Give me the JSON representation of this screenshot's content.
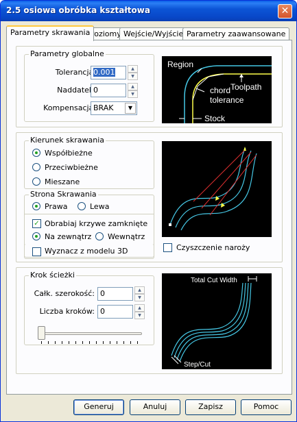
{
  "window": {
    "title": "2.5 osiowa obróbka kształtowa",
    "close_glyph": "✕"
  },
  "tabs": [
    "Parametry skrawania",
    "Poziomy",
    "Wejście/Wyjście",
    "Parametry zaawansowane"
  ],
  "active_tab": 0,
  "global": {
    "title": "Parametry globalne",
    "tolerance_label": "Tolerancja:",
    "tolerance_value": "0.001",
    "allowance_label": "Naddatek:",
    "allowance_value": "0",
    "compensation_label": "Kompensacja:",
    "compensation_value": "BRAK"
  },
  "diagram1": {
    "region": "Region",
    "toolpath": "Toolpath",
    "chord": "chord",
    "tolerance": "tolerance",
    "stock": "Stock"
  },
  "direction": {
    "title": "Kierunek skrawania",
    "options": [
      "Współbieżne",
      "Przeciwbieżne",
      "Mieszane"
    ],
    "selected": 0
  },
  "side": {
    "title": "Strona Skrawania",
    "options": [
      "Prawa",
      "Lewa"
    ],
    "selected": 0
  },
  "closed_curves": {
    "label": "Obrabiaj krzywe zamknięte",
    "checked": true,
    "options": [
      "Na zewnątrz",
      "Wewnątrz"
    ],
    "selected": 0
  },
  "from_model": {
    "label": "Wyznacz z modelu 3D",
    "checked": false
  },
  "corner_clean": {
    "label": "Czyszczenie naroży",
    "checked": false
  },
  "step": {
    "title": "Krok ścieżki",
    "total_width_label": "Całk. szerokość:",
    "total_width_value": "0",
    "steps_label": "Liczba kroków:",
    "steps_value": "0",
    "slider_value": 0
  },
  "diagram3": {
    "total_cut_width": "Total Cut Width",
    "step_cut": "Step/Cut"
  },
  "buttons": {
    "generate": "Generuj",
    "cancel": "Anuluj",
    "save": "Zapisz",
    "help": "Pomoc"
  },
  "colors": {
    "title_bar": "#0a54d8",
    "tab_highlight": "#ffc83c",
    "diagram_curve": "#46c8e6",
    "diagram_path": "#ffff4a"
  }
}
